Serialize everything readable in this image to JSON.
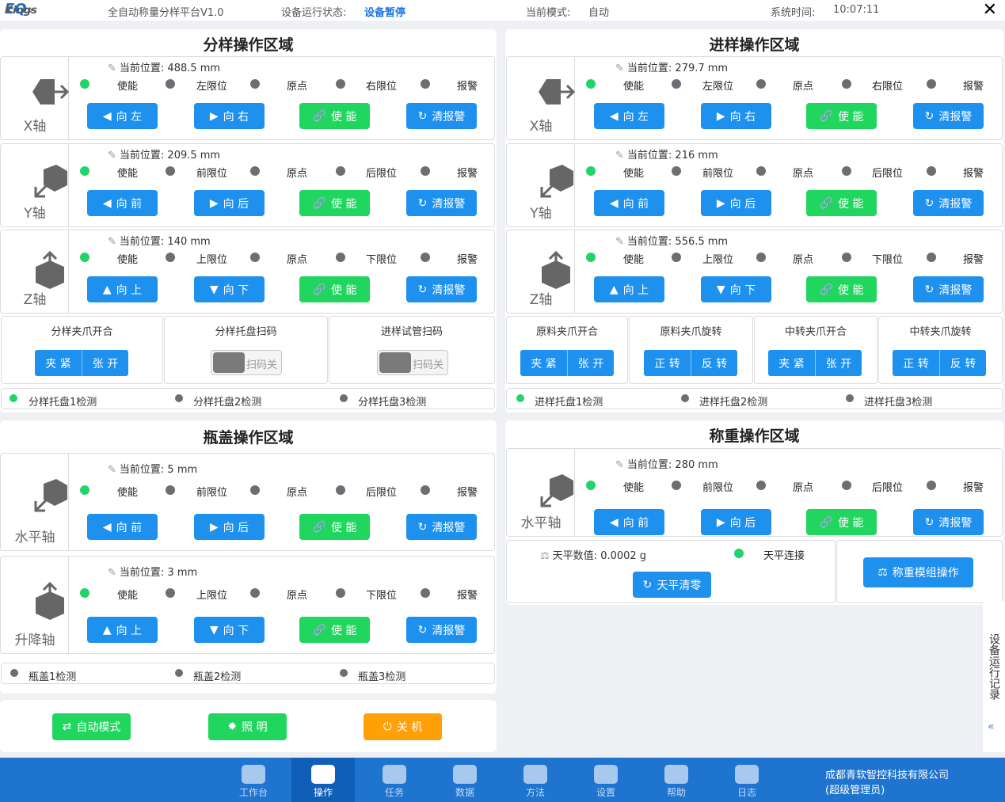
{
  "header": {
    "logo_main": "Kings",
    "logo_accent": "EQ",
    "logo_arrows": "»",
    "app_title": "全自动称量分样平台V1.0",
    "status_label": "设备运行状态:",
    "status_value": "设备暂停",
    "mode_label": "当前模式:",
    "mode_value": "自动",
    "time_label": "系统时间:",
    "time_value": "10:07:11",
    "close": "✕"
  },
  "labels": {
    "pos": "当前位置:",
    "enable": "使能",
    "home": "原点",
    "alarm": "报警",
    "btn_left": "向 左",
    "btn_right": "向 右",
    "btn_front": "向 前",
    "btn_back": "向 后",
    "btn_up": "向 上",
    "btn_down": "向 下",
    "btn_enable": "使 能",
    "btn_clear": "清报警",
    "clamp": "夹 紧",
    "open": "张 开",
    "fwd": "正 转",
    "rev": "反 转",
    "scan_off": "扫码关",
    "lim_left": "左限位",
    "lim_right": "右限位",
    "lim_front": "前限位",
    "lim_back": "后限位",
    "lim_up": "上限位",
    "lim_down": "下限位"
  },
  "split": {
    "title": "分样操作区域",
    "x": {
      "name": "X轴",
      "pos": "488.5  mm"
    },
    "y": {
      "name": "Y轴",
      "pos": "209.5  mm"
    },
    "z": {
      "name": "Z轴",
      "pos": "140  mm"
    },
    "grip": "分样夹爪开合",
    "scan1": "分样托盘扫码",
    "scan2": "进样试管扫码",
    "d1": "分样托盘1检测",
    "d2": "分样托盘2检测",
    "d3": "分样托盘3检测"
  },
  "feed": {
    "title": "进样操作区域",
    "x": {
      "name": "X轴",
      "pos": "279.7  mm"
    },
    "y": {
      "name": "Y轴",
      "pos": "216  mm"
    },
    "z": {
      "name": "Z轴",
      "pos": "556.5  mm"
    },
    "c1": "原料夹爪开合",
    "c2": "原料夹爪旋转",
    "c3": "中转夹爪开合",
    "c4": "中转夹爪旋转",
    "d1": "进样托盘1检测",
    "d2": "进样托盘2检测",
    "d3": "进样托盘3检测"
  },
  "cap": {
    "title": "瓶盖操作区域",
    "h": {
      "name": "水平轴",
      "pos": "5  mm"
    },
    "v": {
      "name": "升降轴",
      "pos": "3  mm"
    },
    "d1": "瓶盖1检测",
    "d2": "瓶盖2检测",
    "d3": "瓶盖3检测"
  },
  "weigh": {
    "title": "称重操作区域",
    "h": {
      "name": "水平轴",
      "pos": "280  mm"
    },
    "balance_label": "天平数值:",
    "balance_value": "0.0002  g",
    "connect": "天平连接",
    "tare": "天平清零",
    "module": "称重模组操作"
  },
  "actions": {
    "auto": "自动模式",
    "light": "照 明",
    "power": "关 机"
  },
  "nav": [
    "工作台",
    "操作",
    "任务",
    "数据",
    "方法",
    "设置",
    "帮助",
    "日志"
  ],
  "company": {
    "name": "成都青软智控科技有限公司",
    "role": "(超级管理员)"
  },
  "side": {
    "label": "设备运行记录",
    "arrow": "«"
  },
  "colors": {
    "accent": "#1e90ee",
    "ok": "#21d65f",
    "warn": "#ffa008",
    "nav": "#1f74cf"
  }
}
